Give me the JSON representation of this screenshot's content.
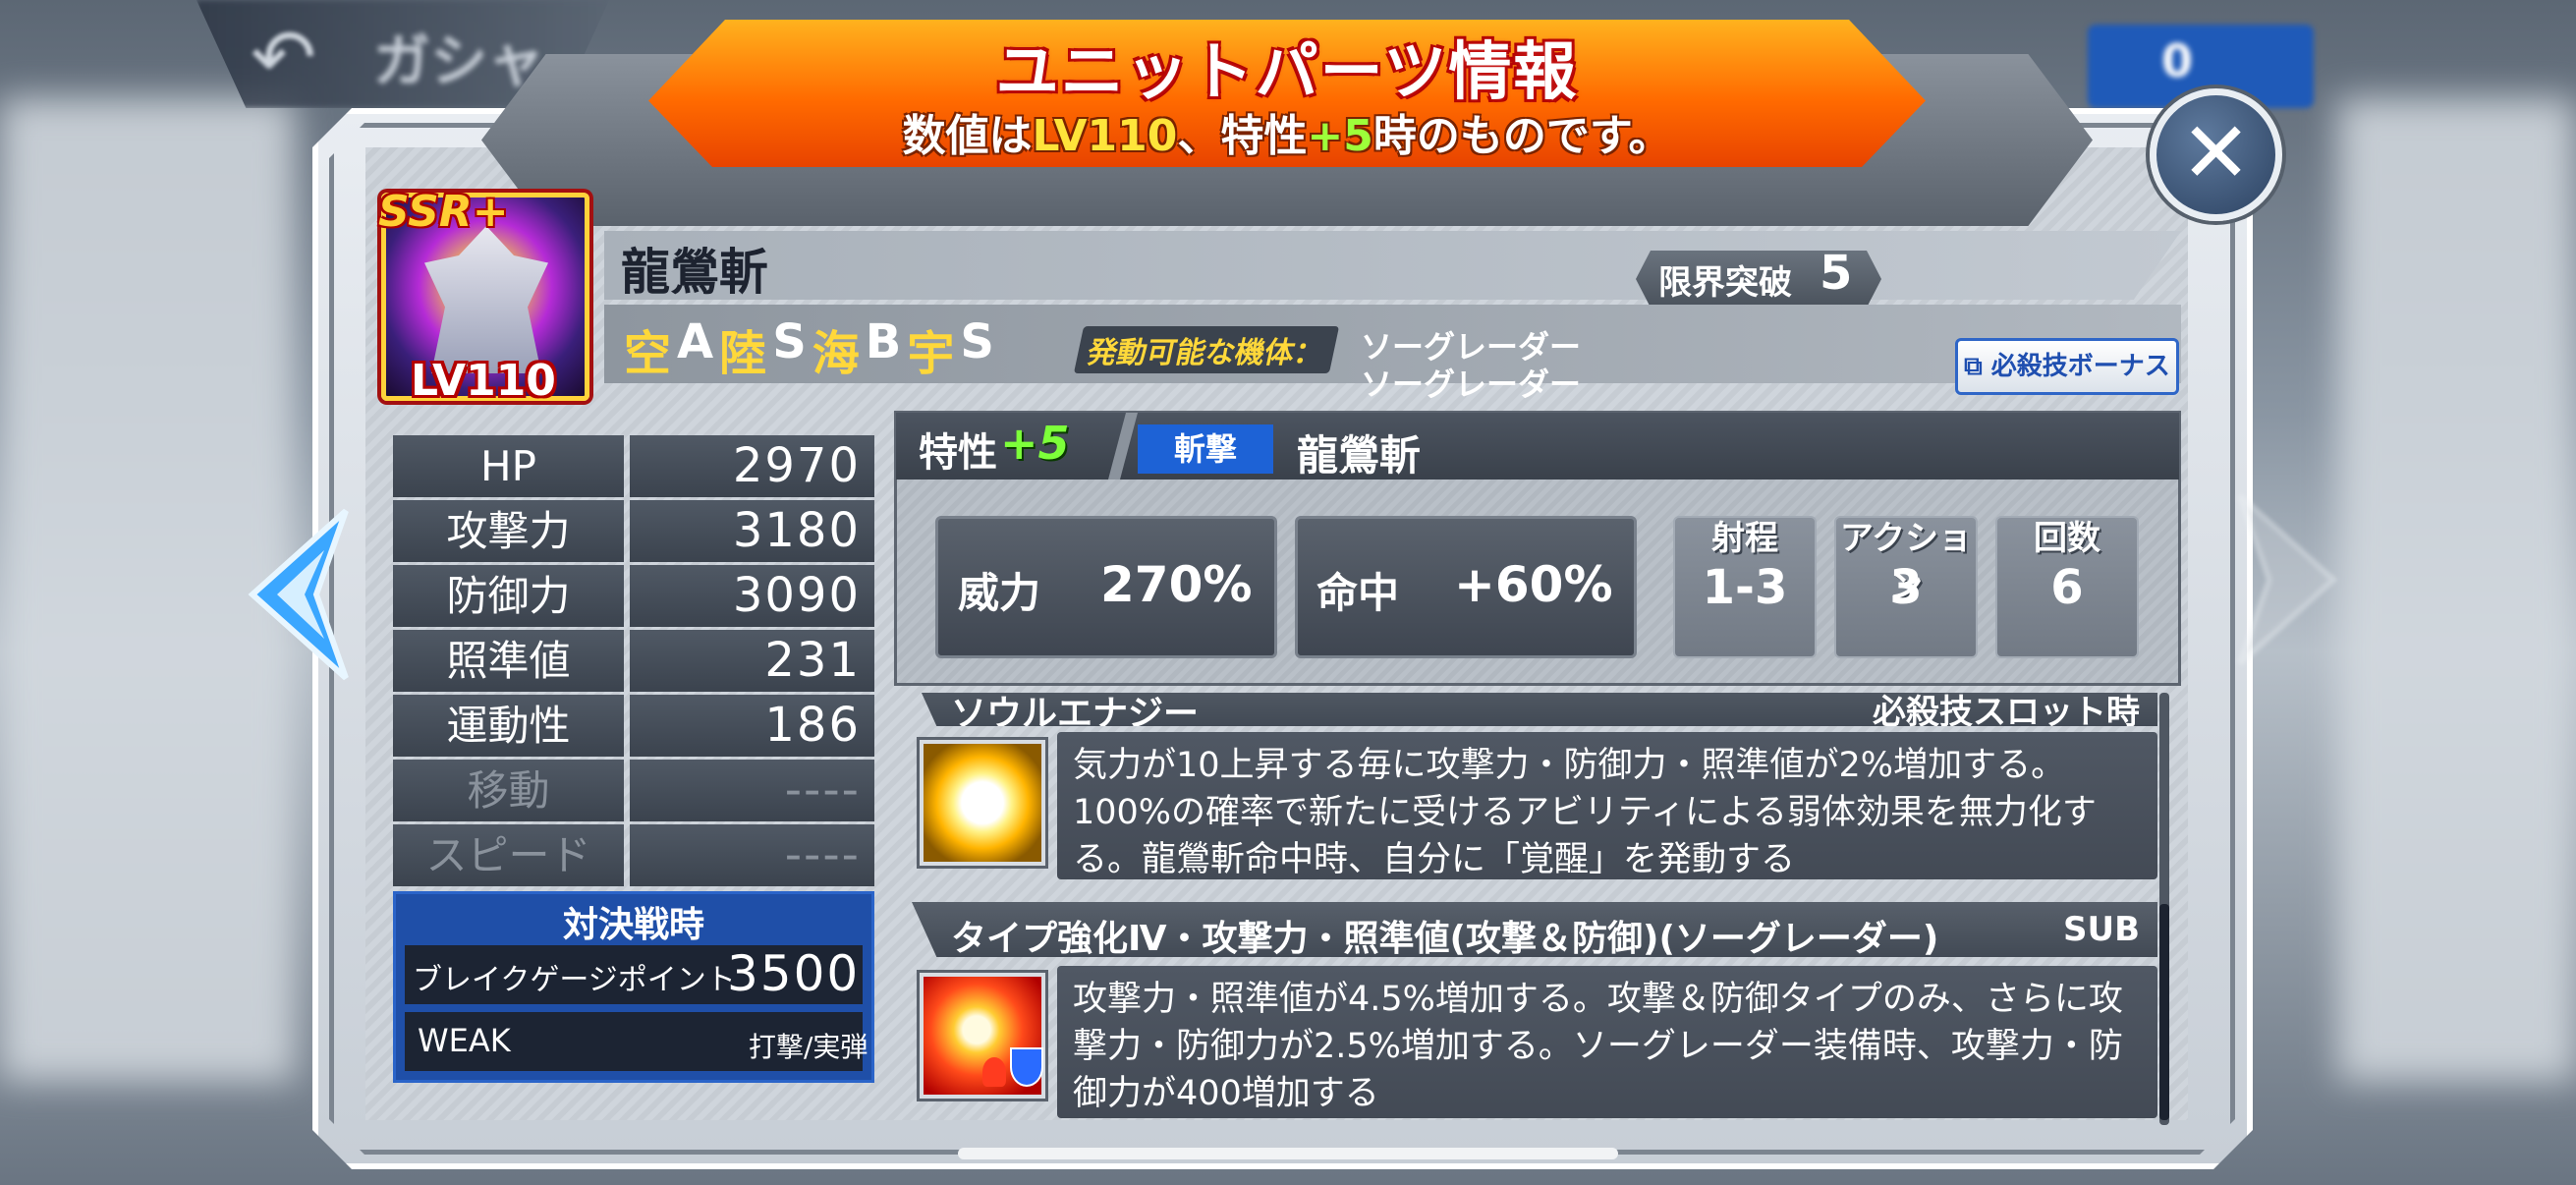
{
  "top_bar": {
    "back_label": "ガシャ",
    "currency_text": "0"
  },
  "banner": {
    "title": "ユニットパーツ情報",
    "sub_prefix": "数値は",
    "sub_lv": "LV110",
    "sub_mid": "、特性",
    "sub_plus": "+5",
    "sub_suffix": "時のものです。"
  },
  "close_label": "✕",
  "unit": {
    "rarity": "SSR+",
    "level": "LV110",
    "name": "龍鶯斬",
    "limit_break_label": "限界突破",
    "limit_break_value": "5",
    "terrain": [
      {
        "label": "空",
        "rank": "A"
      },
      {
        "label": "陸",
        "rank": "S"
      },
      {
        "label": "海",
        "rank": "B"
      },
      {
        "label": "宇",
        "rank": "S"
      }
    ],
    "activation_label": "発動可能な機体：",
    "compatible": [
      "ソーグレーダー",
      "ソーグレーダー"
    ],
    "bonus_button": "必殺技ボーナス"
  },
  "stats": [
    {
      "label": "HP",
      "value": "2970",
      "dim": false
    },
    {
      "label": "攻撃力",
      "value": "3180",
      "dim": false
    },
    {
      "label": "防御力",
      "value": "3090",
      "dim": false
    },
    {
      "label": "照準値",
      "value": "231",
      "dim": false
    },
    {
      "label": "運動性",
      "value": "186",
      "dim": false
    },
    {
      "label": "移動",
      "value": "----",
      "dim": true
    },
    {
      "label": "スピード",
      "value": "----",
      "dim": true
    }
  ],
  "battle": {
    "title": "対決戦時",
    "break_label": "ブレイクゲージポイント",
    "break_value": "3500",
    "weak_label": "WEAK",
    "weak_value": "打撃/実弾"
  },
  "skill": {
    "trait_label": "特性",
    "trait_plus": "+5",
    "type": "斬撃",
    "name": "龍鶯斬",
    "power_label": "威力",
    "power_value": "270%",
    "accuracy_label": "命中",
    "accuracy_value": "+60%",
    "range_label": "射程",
    "range_value": "1-3",
    "action_label": "アクション",
    "action_value": "3",
    "count_label": "回数",
    "count_value": "6"
  },
  "abilities": [
    {
      "header": "ソウルエナジー",
      "tag": "必殺技スロット時",
      "text": "気力が10上昇する毎に攻撃力・防御力・照準値が2%増加する。100%の確率で新たに受けるアビリティによる弱体効果を無力化する。龍鶯斬命中時、自分に「覚醒」を発動する",
      "icon": "sun-burst-icon"
    },
    {
      "header": "タイプ強化Ⅳ・攻撃力・照準値(攻撃＆防御)(ソーグレーダー)",
      "tag": "SUB",
      "text": "攻撃力・照準値が4.5%増加する。攻撃＆防御タイプのみ、さらに攻撃力・防御力が2.5%増加する。ソーグレーダー装備時、攻撃力・防御力が400増加する",
      "icon": "explosion-icon"
    }
  ]
}
